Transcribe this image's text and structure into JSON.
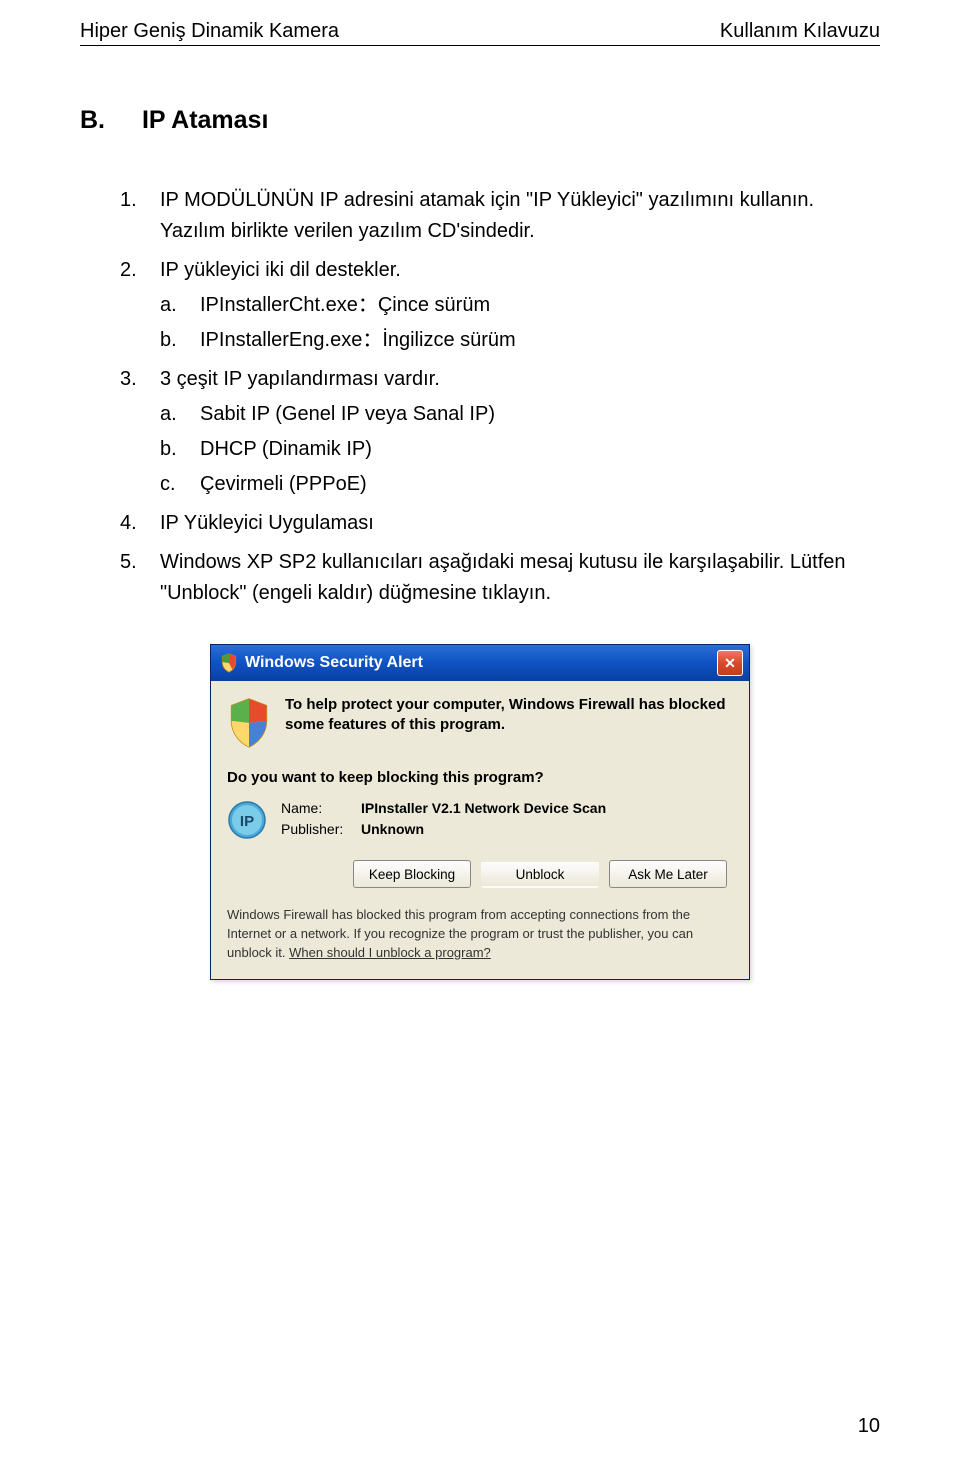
{
  "header": {
    "left": "Hiper Geniş Dinamik Kamera",
    "right": "Kullanım Kılavuzu"
  },
  "section": {
    "letter": "B.",
    "title": "IP Ataması"
  },
  "list": {
    "item1": "IP MODÜLÜNÜN IP adresini atamak için \"IP Yükleyici\" yazılımını kullanın.",
    "item1b": "Yazılım birlikte verilen yazılım CD'sindedir.",
    "item2": "IP yükleyici iki dil destekler.",
    "item2a": "IPInstallerCht.exe：Çince sürüm",
    "item2b": "IPInstallerEng.exe：İngilizce sürüm",
    "item3": "3 çeşit IP yapılandırması vardır.",
    "item3a": "Sabit IP (Genel IP veya Sanal IP)",
    "item3b": "DHCP (Dinamik IP)",
    "item3c": "Çevirmeli (PPPoE)",
    "item4": "IP Yükleyici Uygulaması",
    "item5": "Windows XP SP2 kullanıcıları aşağıdaki mesaj kutusu ile karşılaşabilir. Lütfen \"Unblock\" (engeli kaldır) düğmesine tıklayın."
  },
  "dialog": {
    "title": "Windows Security Alert",
    "topText": "To help protect your computer, Windows Firewall has blocked some features of this program.",
    "question": "Do you want to keep blocking this program?",
    "nameLabel": "Name:",
    "nameValue": "IPInstaller V2.1 Network Device Scan",
    "publisherLabel": "Publisher:",
    "publisherValue": "Unknown",
    "btnKeep": "Keep Blocking",
    "btnUnblock": "Unblock",
    "btnLater": "Ask Me Later",
    "footerText": "Windows Firewall has blocked this program from accepting connections from the Internet or a network. If you recognize the program or trust the publisher, you can unblock it. ",
    "footerLink": "When should I unblock a program?"
  },
  "pageNumber": "10"
}
